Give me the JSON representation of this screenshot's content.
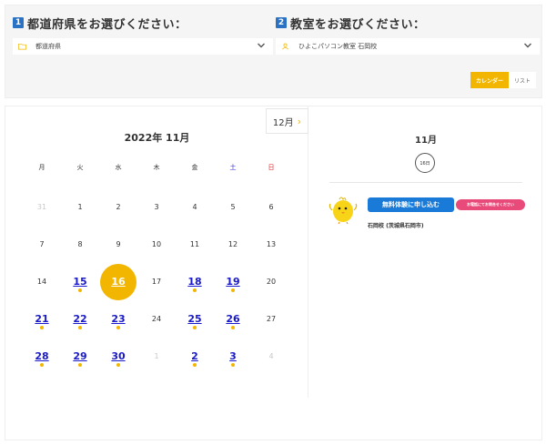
{
  "filters": {
    "prefecture": {
      "number": "1",
      "heading": "都道府県をお選びください：",
      "value": "都道府県",
      "icon": "folder-icon"
    },
    "school": {
      "number": "2",
      "heading": "教室をお選びください：",
      "value": "ひよこパソコン教室 石岡校",
      "icon": "person-icon"
    }
  },
  "view_toggle": {
    "calendar_label": "カレンダー",
    "list_label": "リスト"
  },
  "calendar": {
    "title": "2022年 11月",
    "next_month_label": "12月",
    "weekdays": [
      "月",
      "火",
      "水",
      "木",
      "金",
      "土",
      "日"
    ],
    "weeks": [
      [
        {
          "day": "31",
          "state": "muted",
          "dot": false
        },
        {
          "day": "1",
          "state": "normal",
          "dot": false
        },
        {
          "day": "2",
          "state": "normal",
          "dot": false
        },
        {
          "day": "3",
          "state": "normal",
          "dot": false
        },
        {
          "day": "4",
          "state": "normal",
          "dot": false
        },
        {
          "day": "5",
          "state": "normal",
          "dot": false
        },
        {
          "day": "6",
          "state": "normal",
          "dot": false
        }
      ],
      [
        {
          "day": "7",
          "state": "normal",
          "dot": false
        },
        {
          "day": "8",
          "state": "normal",
          "dot": false
        },
        {
          "day": "9",
          "state": "normal",
          "dot": false
        },
        {
          "day": "10",
          "state": "normal",
          "dot": false
        },
        {
          "day": "11",
          "state": "normal",
          "dot": false
        },
        {
          "day": "12",
          "state": "normal",
          "dot": false
        },
        {
          "day": "13",
          "state": "normal",
          "dot": false
        }
      ],
      [
        {
          "day": "14",
          "state": "normal",
          "dot": false
        },
        {
          "day": "15",
          "state": "link",
          "dot": true
        },
        {
          "day": "16",
          "state": "selected",
          "dot": false
        },
        {
          "day": "17",
          "state": "normal",
          "dot": false
        },
        {
          "day": "18",
          "state": "link",
          "dot": true
        },
        {
          "day": "19",
          "state": "link",
          "dot": true
        },
        {
          "day": "20",
          "state": "normal",
          "dot": false
        }
      ],
      [
        {
          "day": "21",
          "state": "link",
          "dot": true
        },
        {
          "day": "22",
          "state": "link",
          "dot": true
        },
        {
          "day": "23",
          "state": "link",
          "dot": true
        },
        {
          "day": "24",
          "state": "normal",
          "dot": false
        },
        {
          "day": "25",
          "state": "link",
          "dot": true
        },
        {
          "day": "26",
          "state": "link",
          "dot": true
        },
        {
          "day": "27",
          "state": "normal",
          "dot": false
        }
      ],
      [
        {
          "day": "28",
          "state": "link",
          "dot": true
        },
        {
          "day": "29",
          "state": "link",
          "dot": true
        },
        {
          "day": "30",
          "state": "link",
          "dot": true
        },
        {
          "day": "1",
          "state": "muted",
          "dot": false
        },
        {
          "day": "2",
          "state": "link",
          "dot": true
        },
        {
          "day": "3",
          "state": "link",
          "dot": true
        },
        {
          "day": "4",
          "state": "muted",
          "dot": false
        }
      ]
    ]
  },
  "detail": {
    "month": "11月",
    "day_badge": "16日",
    "trial_button": "無料体験に申し込む",
    "phone_button": "お電話にてお問合せください",
    "school_name": "石岡校 (茨城県石岡市)",
    "mascot": "chick-icon"
  },
  "colors": {
    "accent": "#f2b600",
    "badge_blue": "#2a72c4",
    "link_blue": "#1a1acc",
    "trial_blue": "#1a7ad8",
    "phone_pink": "#e84a7a",
    "saturday": "#2a2ad6",
    "sunday": "#e0202a"
  }
}
